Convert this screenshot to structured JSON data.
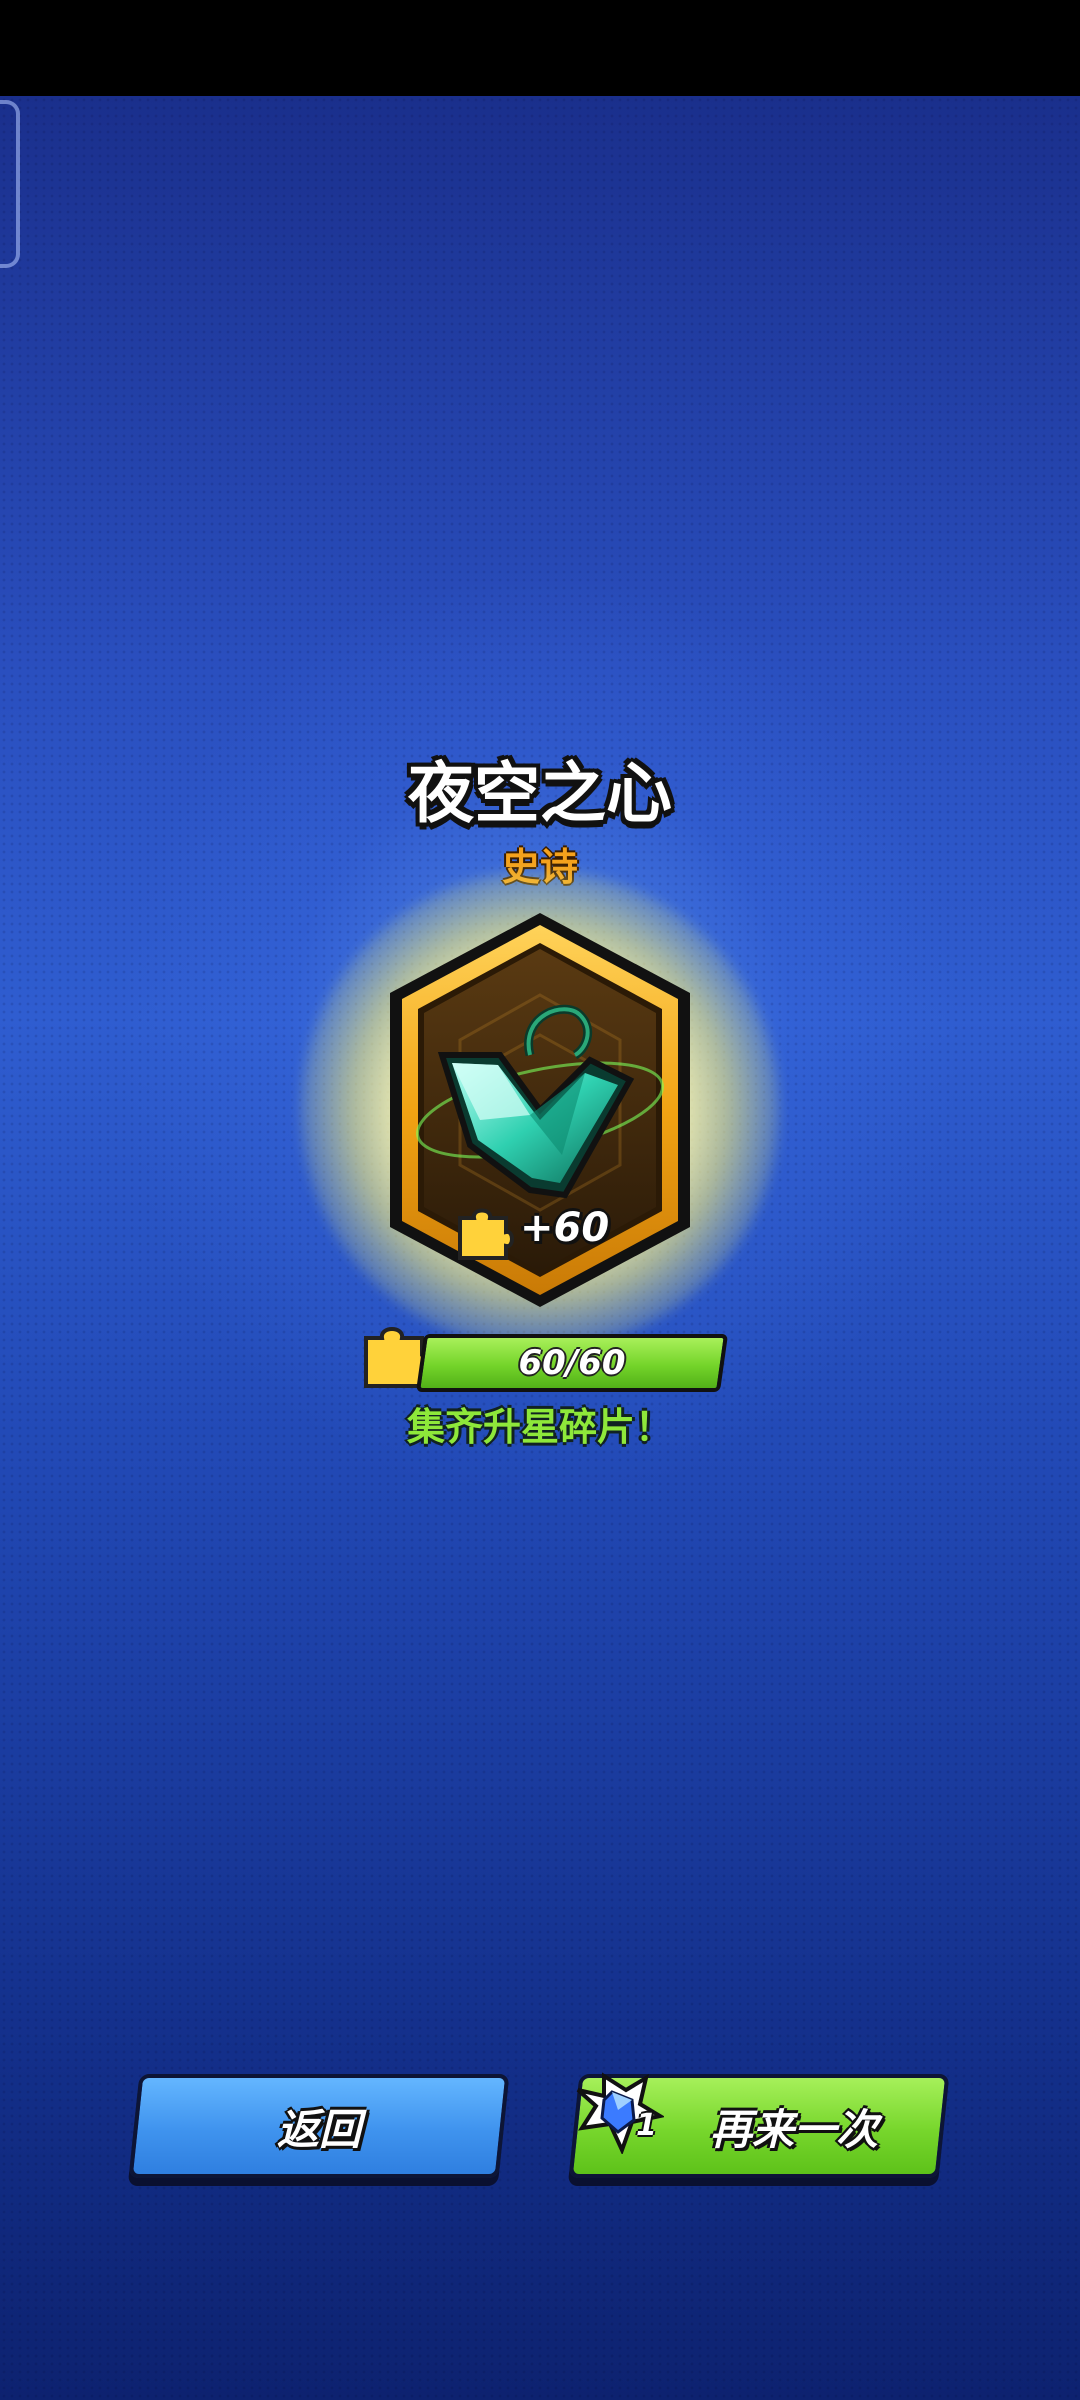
{
  "item": {
    "name": "夜空之心",
    "rarity": "史诗",
    "rarity_color": "#f5a21c",
    "icon": "green-gem-pendant-icon",
    "shard_gain": "+60"
  },
  "progress": {
    "label": "60/60",
    "current": 60,
    "total": 60,
    "fill_color": "#74d42a"
  },
  "message": "集齐升星碎片！",
  "buttons": {
    "back_label": "返回",
    "again_label": "再来一次",
    "again_cost": "1",
    "back_color": "#3f93ee",
    "again_color": "#77d62c"
  }
}
